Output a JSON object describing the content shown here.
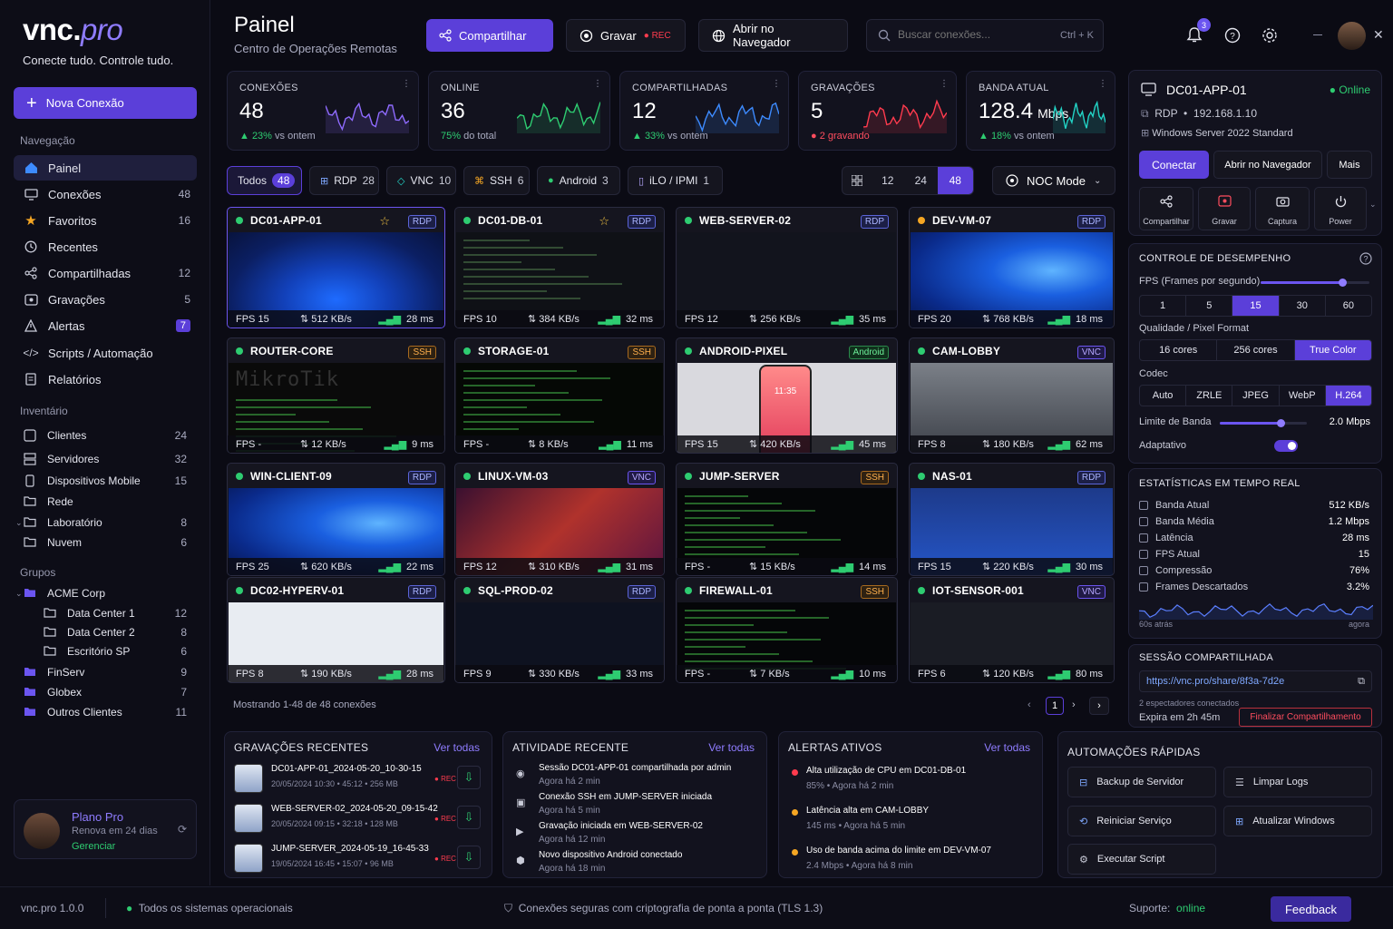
{
  "brand": {
    "name_a": "vnc.",
    "name_b": "pro",
    "tagline": "Conecte tudo. Controle tudo."
  },
  "sidebar": {
    "new_conn": "Nova Conexão",
    "nav_title": "Navegação",
    "nav": [
      {
        "label": "Painel",
        "count": ""
      },
      {
        "label": "Conexões",
        "count": "48"
      },
      {
        "label": "Favoritos",
        "count": "16"
      },
      {
        "label": "Recentes",
        "count": ""
      },
      {
        "label": "Compartilhadas",
        "count": "12"
      },
      {
        "label": "Gravações",
        "count": "5"
      },
      {
        "label": "Alertas",
        "count": "7"
      },
      {
        "label": "Scripts / Automação",
        "count": ""
      },
      {
        "label": "Relatórios",
        "count": ""
      }
    ],
    "inv_title": "Inventário",
    "inv": [
      {
        "label": "Clientes",
        "count": "24"
      },
      {
        "label": "Servidores",
        "count": "32"
      },
      {
        "label": "Dispositivos Mobile",
        "count": "15"
      },
      {
        "label": "Rede",
        "count": ""
      },
      {
        "label": "Laboratório",
        "count": "8"
      },
      {
        "label": "Nuvem",
        "count": "6"
      }
    ],
    "groups_title": "Grupos",
    "groups": [
      {
        "label": "ACME Corp",
        "count": ""
      },
      {
        "label": "Data Center 1",
        "count": "12"
      },
      {
        "label": "Data Center 2",
        "count": "8"
      },
      {
        "label": "Escritório SP",
        "count": "6"
      },
      {
        "label": "FinServ",
        "count": "9"
      },
      {
        "label": "Globex",
        "count": "7"
      },
      {
        "label": "Outros Clientes",
        "count": "11"
      }
    ],
    "plan": {
      "title": "Plano Pro",
      "renew": "Renova em 24 dias",
      "manage": "Gerenciar"
    }
  },
  "header": {
    "title": "Painel",
    "subtitle": "Centro de Operações Remotas",
    "share": "Compartilhar",
    "record": "Gravar",
    "rec": "REC",
    "open_browser": "Abrir no Navegador",
    "search_placeholder": "Buscar conexões...",
    "shortcut": "Ctrl + K",
    "notif_count": "3"
  },
  "stats": [
    {
      "label": "CONEXÕES",
      "value": "48",
      "unit": "",
      "delta": "▲ 23%",
      "note": "vs ontem",
      "color": "#8f6bff"
    },
    {
      "label": "ONLINE",
      "value": "36",
      "unit": "",
      "delta": "75%",
      "note": "do total",
      "color": "#2ecc71"
    },
    {
      "label": "COMPARTILHADAS",
      "value": "12",
      "unit": "",
      "delta": "▲ 33%",
      "note": "vs ontem",
      "color": "#3d8bff"
    },
    {
      "label": "GRAVAÇÕES",
      "value": "5",
      "unit": "",
      "delta": "● 2 gravando",
      "note": "",
      "color": "#ff3b4e"
    },
    {
      "label": "BANDA ATUAL",
      "value": "128.4",
      "unit": "Mbps",
      "delta": "▲ 18%",
      "note": "vs ontem",
      "color": "#22d3c5"
    }
  ],
  "filters": [
    {
      "label": "Todos",
      "count": "48"
    },
    {
      "label": "RDP",
      "count": "28"
    },
    {
      "label": "VNC",
      "count": "10"
    },
    {
      "label": "SSH",
      "count": "6"
    },
    {
      "label": "Android",
      "count": "3"
    },
    {
      "label": "iLO / IPMI",
      "count": "1"
    }
  ],
  "grid_sizes": [
    "12",
    "24",
    "48"
  ],
  "noc": "NOC Mode",
  "tiles": [
    {
      "name": "DC01-APP-01",
      "tag": "RDP",
      "fps": "FPS 15",
      "bw": "512 KB/s",
      "lat": "28 ms",
      "star": true
    },
    {
      "name": "DC01-DB-01",
      "tag": "RDP",
      "fps": "FPS 10",
      "bw": "384 KB/s",
      "lat": "32 ms",
      "star": true
    },
    {
      "name": "WEB-SERVER-02",
      "tag": "RDP",
      "fps": "FPS 12",
      "bw": "256 KB/s",
      "lat": "35 ms",
      "star": false
    },
    {
      "name": "DEV-VM-07",
      "tag": "RDP",
      "fps": "FPS 20",
      "bw": "768 KB/s",
      "lat": "18 ms",
      "star": false
    },
    {
      "name": "ROUTER-CORE",
      "tag": "SSH",
      "fps": "FPS -",
      "bw": "12 KB/s",
      "lat": "9 ms",
      "star": false
    },
    {
      "name": "STORAGE-01",
      "tag": "SSH",
      "fps": "FPS -",
      "bw": "8 KB/s",
      "lat": "11 ms",
      "star": false
    },
    {
      "name": "ANDROID-PIXEL",
      "tag": "Android",
      "fps": "FPS 15",
      "bw": "420 KB/s",
      "lat": "45 ms",
      "star": false
    },
    {
      "name": "CAM-LOBBY",
      "tag": "VNC",
      "fps": "FPS 8",
      "bw": "180 KB/s",
      "lat": "62 ms",
      "star": false
    },
    {
      "name": "WIN-CLIENT-09",
      "tag": "RDP",
      "fps": "FPS 25",
      "bw": "620 KB/s",
      "lat": "22 ms",
      "star": false
    },
    {
      "name": "LINUX-VM-03",
      "tag": "VNC",
      "fps": "FPS 12",
      "bw": "310 KB/s",
      "lat": "31 ms",
      "star": false
    },
    {
      "name": "JUMP-SERVER",
      "tag": "SSH",
      "fps": "FPS -",
      "bw": "15 KB/s",
      "lat": "14 ms",
      "star": false
    },
    {
      "name": "NAS-01",
      "tag": "RDP",
      "fps": "FPS 15",
      "bw": "220 KB/s",
      "lat": "30 ms",
      "star": false
    },
    {
      "name": "DC02-HYPERV-01",
      "tag": "RDP",
      "fps": "FPS 8",
      "bw": "190 KB/s",
      "lat": "28 ms",
      "star": false
    },
    {
      "name": "SQL-PROD-02",
      "tag": "RDP",
      "fps": "FPS 9",
      "bw": "330 KB/s",
      "lat": "33 ms",
      "star": false
    },
    {
      "name": "FIREWALL-01",
      "tag": "SSH",
      "fps": "FPS -",
      "bw": "7 KB/s",
      "lat": "10 ms",
      "star": false
    },
    {
      "name": "IOT-SENSOR-001",
      "tag": "VNC",
      "fps": "FPS 6",
      "bw": "120 KB/s",
      "lat": "80 ms",
      "star": false
    }
  ],
  "screen_text": {
    "mikrotik": "MikroTik",
    "phone_time": "11:35"
  },
  "paging": {
    "showing": "Mostrando 1-48 de 48 conexões",
    "page": "1"
  },
  "detail": {
    "name": "DC01-APP-01",
    "status": "Online",
    "proto": "RDP",
    "ip": "192.168.1.10",
    "os": "Windows Server 2022 Standard",
    "connect": "Conectar",
    "open": "Abrir no Navegador",
    "more": "Mais",
    "actions": [
      "Compartilhar",
      "Gravar",
      "Captura",
      "Power"
    ]
  },
  "perf": {
    "title": "CONTROLE DE DESEMPENHO",
    "fps_label": "FPS (Frames por segundo)",
    "fps_level": 0.75,
    "fps": [
      "1",
      "5",
      "15",
      "30",
      "60"
    ],
    "fps_on": 2,
    "quality_label": "Qualidade / Pixel Format",
    "quality": [
      "16 cores",
      "256 cores",
      "True Color"
    ],
    "quality_on": 2,
    "codec_label": "Codec",
    "codec": [
      "Auto",
      "ZRLE",
      "JPEG",
      "WebP",
      "H.264"
    ],
    "codec_on": 4,
    "bw_label": "Limite de Banda",
    "bw_value": "2.0 Mbps",
    "bw_level": 0.7,
    "adaptive": "Adaptativo"
  },
  "rt": {
    "title": "ESTATÍSTICAS EM TEMPO REAL",
    "items": [
      {
        "label": "Banda Atual",
        "value": "512 KB/s"
      },
      {
        "label": "Banda Média",
        "value": "1.2 Mbps"
      },
      {
        "label": "Latência",
        "value": "28 ms"
      },
      {
        "label": "FPS Atual",
        "value": "15"
      },
      {
        "label": "Compressão",
        "value": "76%"
      },
      {
        "label": "Frames Descartados",
        "value": "3.2%"
      }
    ],
    "from": "60s atrás",
    "to": "agora"
  },
  "share": {
    "title": "SESSÃO COMPARTILHADA",
    "url": "https://vnc.pro/share/8f3a-7d2e",
    "viewers": "2 espectadores conectados",
    "expires": "Expira em 2h 45m",
    "end": "Finalizar Compartilhamento"
  },
  "recordings": {
    "title": "GRAVAÇÕES RECENTES",
    "see_all": "Ver todas",
    "rec": "REC",
    "items": [
      {
        "name": "DC01-APP-01_2024-05-20_10-30-15",
        "meta": "20/05/2024 10:30 • 45:12 • 256 MB"
      },
      {
        "name": "WEB-SERVER-02_2024-05-20_09-15-42",
        "meta": "20/05/2024 09:15 • 32:18 • 128 MB"
      },
      {
        "name": "JUMP-SERVER_2024-05-19_16-45-33",
        "meta": "19/05/2024 16:45 • 15:07 • 96 MB"
      }
    ]
  },
  "activity": {
    "title": "ATIVIDADE RECENTE",
    "see_all": "Ver todas",
    "items": [
      {
        "text": "Sessão DC01-APP-01 compartilhada por admin",
        "time": "Agora há 2 min"
      },
      {
        "text": "Conexão SSH em JUMP-SERVER iniciada",
        "time": "Agora há 5 min"
      },
      {
        "text": "Gravação iniciada em WEB-SERVER-02",
        "time": "Agora há 12 min"
      },
      {
        "text": "Novo dispositivo Android conectado",
        "time": "Agora há 18 min"
      }
    ]
  },
  "alerts": {
    "title": "ALERTAS ATIVOS",
    "see_all": "Ver todas",
    "items": [
      {
        "text": "Alta utilização de CPU em DC01-DB-01",
        "meta": "85% • Agora há 2 min",
        "color": "#ff3b4e"
      },
      {
        "text": "Latência alta em CAM-LOBBY",
        "meta": "145 ms • Agora há 5 min",
        "color": "#f5a623"
      },
      {
        "text": "Uso de banda acima do limite em DEV-VM-07",
        "meta": "2.4 Mbps • Agora há 8 min",
        "color": "#f5a623"
      }
    ]
  },
  "automations": {
    "title": "AUTOMAÇÕES RÁPIDAS",
    "items": [
      "Backup de Servidor",
      "Limpar Logs",
      "Reiniciar Serviço",
      "Atualizar Windows",
      "Executar Script"
    ]
  },
  "footer": {
    "version": "vnc.pro 1.0.0",
    "systems": "Todos os sistemas operacionais",
    "secure": "Conexões seguras com criptografia de ponta a ponta (TLS 1.3)",
    "support": "Suporte:",
    "support_status": "online",
    "feedback": "Feedback"
  }
}
